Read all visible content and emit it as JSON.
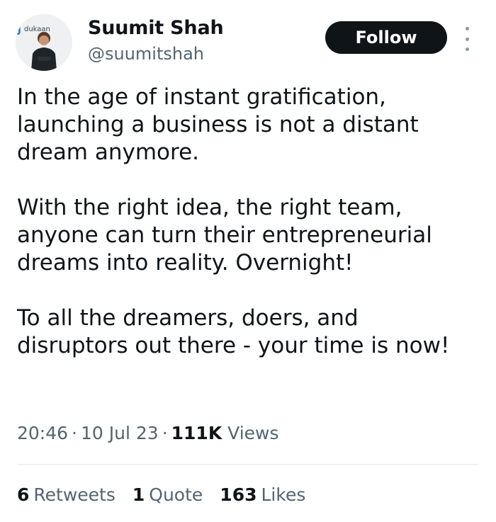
{
  "author": {
    "display_name": "Suumit Shah",
    "handle": "@suumitshah",
    "avatar_icon": "profile-photo"
  },
  "actions": {
    "follow_label": "Follow",
    "more_icon": "vertical-ellipsis-icon"
  },
  "tweet": {
    "paragraphs": [
      [
        "In the age of instant gratification,",
        "launching a business is not a distant",
        "dream anymore."
      ],
      [
        "With the right idea, the right team,",
        "anyone can turn their entrepreneurial",
        "dreams into reality. Overnight!"
      ],
      [
        "To all the dreamers, doers, and",
        "disruptors out there - your time is now!"
      ]
    ]
  },
  "meta": {
    "time": "20:46",
    "separator": "·",
    "date": "10 Jul 23",
    "views_count": "111K",
    "views_label": "Views"
  },
  "stats": {
    "retweets_count": "6",
    "retweets_label": "Retweets",
    "quotes_count": "1",
    "quotes_label": "Quote",
    "likes_count": "163",
    "likes_label": "Likes"
  },
  "colors": {
    "text_primary": "#0f1419",
    "text_secondary": "#536471",
    "follow_bg": "#0f1419",
    "divider": "#e1e6ea"
  }
}
